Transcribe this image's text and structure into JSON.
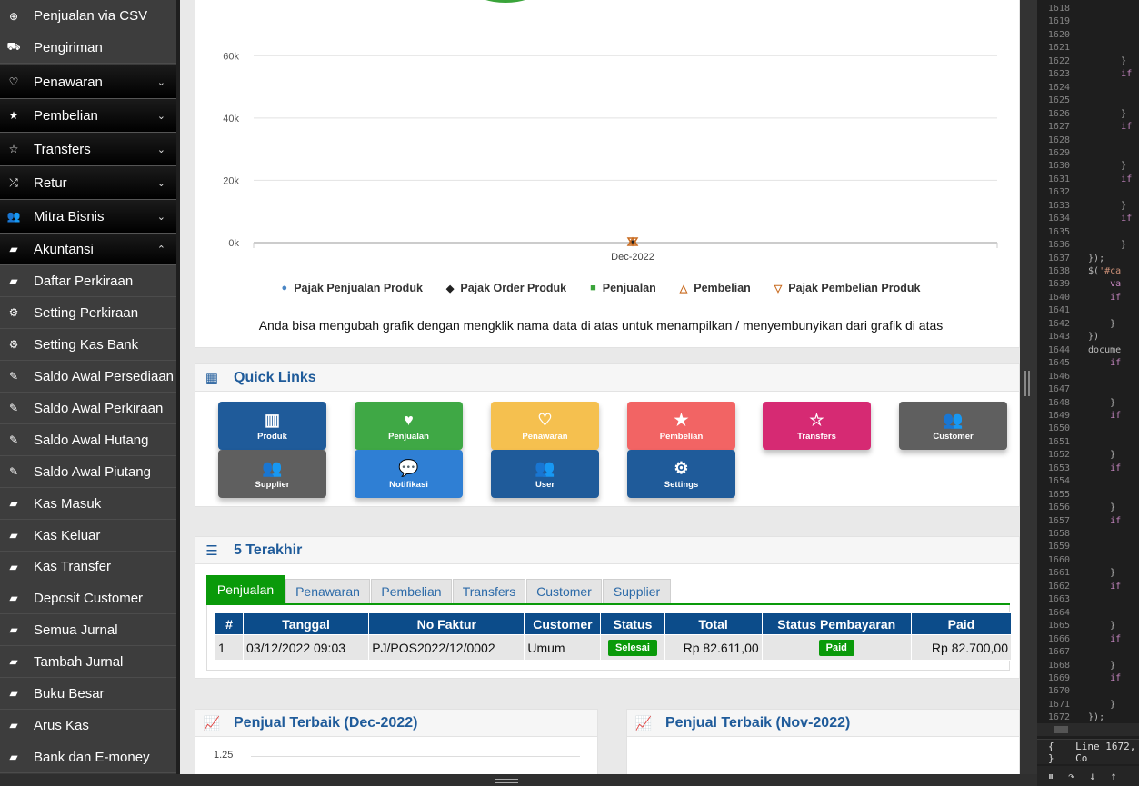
{
  "sidebar": {
    "items": [
      {
        "label": "Penjualan via CSV",
        "icon": "plus-circle-icon",
        "glyph": "⊕",
        "type": "sub"
      },
      {
        "label": "Pengiriman",
        "icon": "truck-icon",
        "glyph": "⛟",
        "type": "sub"
      },
      {
        "label": "Penawaran",
        "icon": "heart-outline-icon",
        "glyph": "♡",
        "type": "group",
        "chev": "⌄"
      },
      {
        "label": "Pembelian",
        "icon": "star-icon",
        "glyph": "★",
        "type": "group",
        "chev": "⌄"
      },
      {
        "label": "Transfers",
        "icon": "star-outline-icon",
        "glyph": "☆",
        "type": "group",
        "chev": "⌄"
      },
      {
        "label": "Retur",
        "icon": "shuffle-icon",
        "glyph": "⤮",
        "type": "group",
        "chev": "⌄"
      },
      {
        "label": "Mitra Bisnis",
        "icon": "users-icon",
        "glyph": "👥",
        "type": "group",
        "chev": "⌄"
      },
      {
        "label": "Akuntansi",
        "icon": "book-icon",
        "glyph": "▰",
        "type": "group",
        "chev": "⌃"
      },
      {
        "label": "Daftar Perkiraan",
        "icon": "book-icon",
        "glyph": "▰",
        "type": "sub"
      },
      {
        "label": "Setting Perkiraan",
        "icon": "gear-icon",
        "glyph": "⚙",
        "type": "sub"
      },
      {
        "label": "Setting Kas Bank",
        "icon": "gear-icon",
        "glyph": "⚙",
        "type": "sub"
      },
      {
        "label": "Saldo Awal Persediaan",
        "icon": "pencil-icon",
        "glyph": "✎",
        "type": "sub"
      },
      {
        "label": "Saldo Awal Perkiraan",
        "icon": "pencil-icon",
        "glyph": "✎",
        "type": "sub"
      },
      {
        "label": "Saldo Awal Hutang",
        "icon": "pencil-icon",
        "glyph": "✎",
        "type": "sub"
      },
      {
        "label": "Saldo Awal Piutang",
        "icon": "pencil-icon",
        "glyph": "✎",
        "type": "sub"
      },
      {
        "label": "Kas Masuk",
        "icon": "book-icon",
        "glyph": "▰",
        "type": "sub"
      },
      {
        "label": "Kas Keluar",
        "icon": "book-icon",
        "glyph": "▰",
        "type": "sub"
      },
      {
        "label": "Kas Transfer",
        "icon": "book-icon",
        "glyph": "▰",
        "type": "sub"
      },
      {
        "label": "Deposit Customer",
        "icon": "book-icon",
        "glyph": "▰",
        "type": "sub"
      },
      {
        "label": "Semua Jurnal",
        "icon": "book-icon",
        "glyph": "▰",
        "type": "sub"
      },
      {
        "label": "Tambah Jurnal",
        "icon": "book-icon",
        "glyph": "▰",
        "type": "sub"
      },
      {
        "label": "Buku Besar",
        "icon": "book-icon",
        "glyph": "▰",
        "type": "sub"
      },
      {
        "label": "Arus Kas",
        "icon": "book-icon",
        "glyph": "▰",
        "type": "sub"
      },
      {
        "label": "Bank dan E-money",
        "icon": "book-icon",
        "glyph": "▰",
        "type": "sub"
      }
    ]
  },
  "chart_data": {
    "type": "line",
    "categories": [
      "Dec-2022"
    ],
    "ylim": [
      0,
      70000
    ],
    "y_ticks": [
      "0k",
      "20k",
      "40k",
      "60k"
    ],
    "series": [
      {
        "name": "Pajak Penjualan Produk",
        "values": [
          0
        ],
        "color": "#4a86c5",
        "marker": "circle"
      },
      {
        "name": "Pajak Order Produk",
        "values": [
          0
        ],
        "color": "#222222",
        "marker": "diamond"
      },
      {
        "name": "Penjualan",
        "values": [
          82611
        ],
        "color": "#3aa43a",
        "marker": "square"
      },
      {
        "name": "Pembelian",
        "values": [
          0
        ],
        "color": "#c86a1e",
        "marker": "triangle"
      },
      {
        "name": "Pajak Pembelian Produk",
        "values": [
          0
        ],
        "color": "#c86a1e",
        "marker": "triangle-down"
      }
    ],
    "legend": "bottom",
    "note": "Anda bisa mengubah grafik dengan mengklik nama data di atas untuk menampilkan / menyembunyikan dari grafik di atas"
  },
  "quick_links": {
    "title": "Quick Links",
    "items": [
      {
        "label": "Produk",
        "icon": "barcode-icon",
        "glyph": "▥",
        "color": "#1f5b9a"
      },
      {
        "label": "Penjualan",
        "icon": "heart-icon",
        "glyph": "♥",
        "color": "#3fa845"
      },
      {
        "label": "Penawaran",
        "icon": "heart-outline-icon",
        "glyph": "♡",
        "color": "#f5c04f"
      },
      {
        "label": "Pembelian",
        "icon": "star-icon",
        "glyph": "★",
        "color": "#f26464"
      },
      {
        "label": "Transfers",
        "icon": "star-outline-icon",
        "glyph": "☆",
        "color": "#d62a73"
      },
      {
        "label": "Customer",
        "icon": "users-icon",
        "glyph": "👥",
        "color": "#5f5f5f"
      },
      {
        "label": "Supplier",
        "icon": "users-icon",
        "glyph": "👥",
        "color": "#5f5f5f"
      },
      {
        "label": "Notifikasi",
        "icon": "comments-icon",
        "glyph": "💬",
        "color": "#2f7fd4"
      },
      {
        "label": "User",
        "icon": "users-icon",
        "glyph": "👥",
        "color": "#1f5b9a"
      },
      {
        "label": "Settings",
        "icon": "gears-icon",
        "glyph": "⚙",
        "color": "#1f5b9a"
      }
    ]
  },
  "recent": {
    "title": "5 Terakhir",
    "tabs": [
      "Penjualan",
      "Penawaran",
      "Pembelian",
      "Transfers",
      "Customer",
      "Supplier"
    ],
    "columns": [
      "#",
      "Tanggal",
      "No Faktur",
      "Customer",
      "Status",
      "Total",
      "Status Pembayaran",
      "Paid"
    ],
    "rows": [
      {
        "no": "1",
        "tanggal": "03/12/2022 09:03",
        "faktur": "PJ/POS2022/12/0002",
        "customer": "Umum",
        "status": "Selesai",
        "total": "Rp 82.611,00",
        "status_bayar": "Paid",
        "paid": "Rp 82.700,00"
      }
    ]
  },
  "best_sellers": {
    "dec_title": "Penjual Terbaik (Dec-2022)",
    "nov_title": "Penjual Terbaik (Nov-2022)",
    "dec_tick": "1.25"
  },
  "code": {
    "lines": [
      {
        "n": "1618",
        "t": ""
      },
      {
        "n": "1619",
        "t": ""
      },
      {
        "n": "1620",
        "t": ""
      },
      {
        "n": "1621",
        "t": ""
      },
      {
        "n": "1622",
        "t": "        }"
      },
      {
        "n": "1623",
        "t": "        if"
      },
      {
        "n": "1624",
        "t": ""
      },
      {
        "n": "1625",
        "t": ""
      },
      {
        "n": "1626",
        "t": "        }"
      },
      {
        "n": "1627",
        "t": "        if"
      },
      {
        "n": "1628",
        "t": ""
      },
      {
        "n": "1629",
        "t": ""
      },
      {
        "n": "1630",
        "t": "        }"
      },
      {
        "n": "1631",
        "t": "        if"
      },
      {
        "n": "1632",
        "t": ""
      },
      {
        "n": "1633",
        "t": "        }"
      },
      {
        "n": "1634",
        "t": "        if"
      },
      {
        "n": "1635",
        "t": ""
      },
      {
        "n": "1636",
        "t": "        }"
      },
      {
        "n": "1637",
        "t": "  });"
      },
      {
        "n": "1638",
        "t": "  $('#ca"
      },
      {
        "n": "1639",
        "t": "      va"
      },
      {
        "n": "1640",
        "t": "      if"
      },
      {
        "n": "1641",
        "t": ""
      },
      {
        "n": "1642",
        "t": "      }"
      },
      {
        "n": "1643",
        "t": "  })"
      },
      {
        "n": "1644",
        "t": "  docume"
      },
      {
        "n": "1645",
        "t": "      if"
      },
      {
        "n": "1646",
        "t": ""
      },
      {
        "n": "1647",
        "t": ""
      },
      {
        "n": "1648",
        "t": "      }"
      },
      {
        "n": "1649",
        "t": "      if"
      },
      {
        "n": "1650",
        "t": ""
      },
      {
        "n": "1651",
        "t": ""
      },
      {
        "n": "1652",
        "t": "      }"
      },
      {
        "n": "1653",
        "t": "      if"
      },
      {
        "n": "1654",
        "t": ""
      },
      {
        "n": "1655",
        "t": ""
      },
      {
        "n": "1656",
        "t": "      }"
      },
      {
        "n": "1657",
        "t": "      if"
      },
      {
        "n": "1658",
        "t": ""
      },
      {
        "n": "1659",
        "t": ""
      },
      {
        "n": "1660",
        "t": ""
      },
      {
        "n": "1661",
        "t": "      }"
      },
      {
        "n": "1662",
        "t": "      if"
      },
      {
        "n": "1663",
        "t": ""
      },
      {
        "n": "1664",
        "t": ""
      },
      {
        "n": "1665",
        "t": "      }"
      },
      {
        "n": "1666",
        "t": "      if"
      },
      {
        "n": "1667",
        "t": ""
      },
      {
        "n": "1668",
        "t": "      }"
      },
      {
        "n": "1669",
        "t": "      if"
      },
      {
        "n": "1670",
        "t": ""
      },
      {
        "n": "1671",
        "t": "      }"
      },
      {
        "n": "1672",
        "t": "  });"
      }
    ],
    "status_braces": "{ }",
    "status_position": "Line 1672, Co"
  }
}
